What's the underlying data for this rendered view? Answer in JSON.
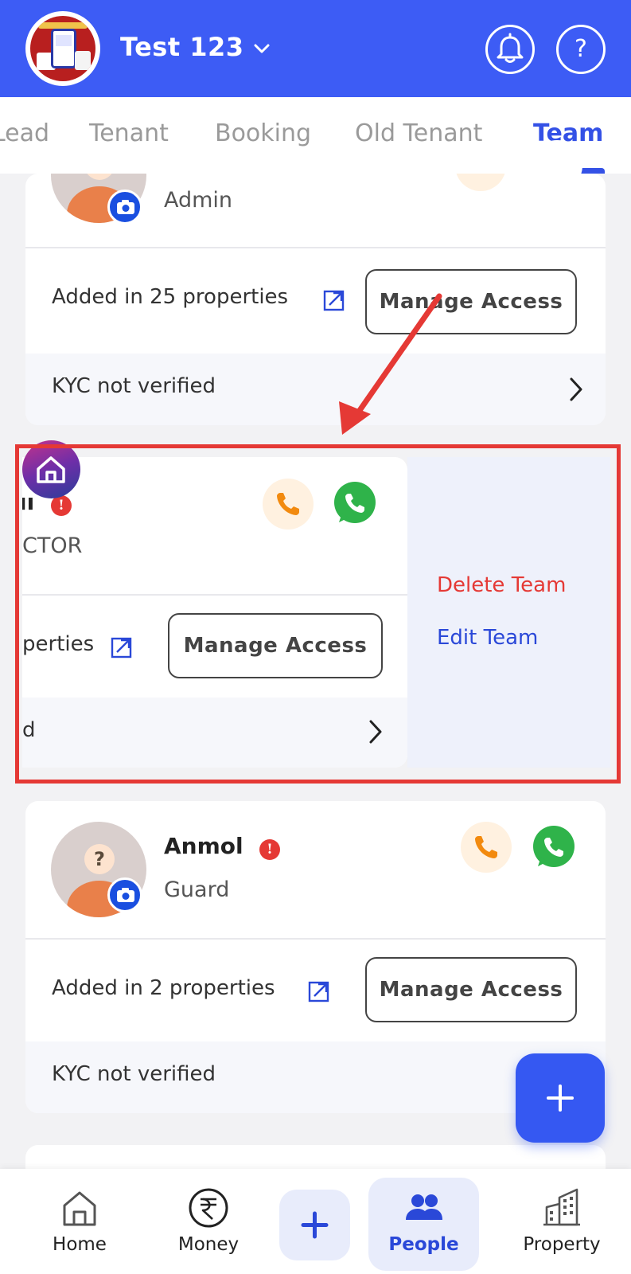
{
  "header": {
    "title": "Test 123",
    "colors": {
      "bar": "#3d5cf5",
      "accent": "#3451e6"
    },
    "icons": [
      "chevron-down-icon",
      "bell-icon",
      "help-icon"
    ]
  },
  "tabs": [
    {
      "label": "Lead",
      "active": false
    },
    {
      "label": "Tenant",
      "active": false
    },
    {
      "label": "Booking",
      "active": false
    },
    {
      "label": "Old Tenant",
      "active": false
    },
    {
      "label": "Team",
      "active": true
    }
  ],
  "cards": [
    {
      "role": "Admin",
      "added": "Added in 25 properties",
      "manage": "Manage Access",
      "kyc": "KYC not verified"
    },
    {
      "name_fragment": "ıı",
      "role_fragment": "CTOR",
      "added_fragment": "perties",
      "manage": "Manage Access",
      "kyc_fragment": "d"
    },
    {
      "name": "Anmol",
      "role": "Guard",
      "added": "Added in 2 properties",
      "manage": "Manage Access",
      "kyc": "KYC not verified"
    }
  ],
  "swipe_actions": {
    "delete": "Delete Team",
    "edit": "Edit Team",
    "colors": {
      "delete": "#e53935",
      "edit": "#2a48d8"
    }
  },
  "fab": {
    "icon": "plus-icon"
  },
  "bottom_nav": [
    {
      "label": "Home",
      "icon": "home-icon",
      "active": false
    },
    {
      "label": "Money",
      "icon": "rupee-icon",
      "active": false
    },
    {
      "label": "",
      "icon": "plus-icon",
      "active": false
    },
    {
      "label": "People",
      "icon": "people-icon",
      "active": true
    },
    {
      "label": "Property",
      "icon": "building-icon",
      "active": false
    }
  ],
  "annotation": {
    "color": "#e53935"
  }
}
